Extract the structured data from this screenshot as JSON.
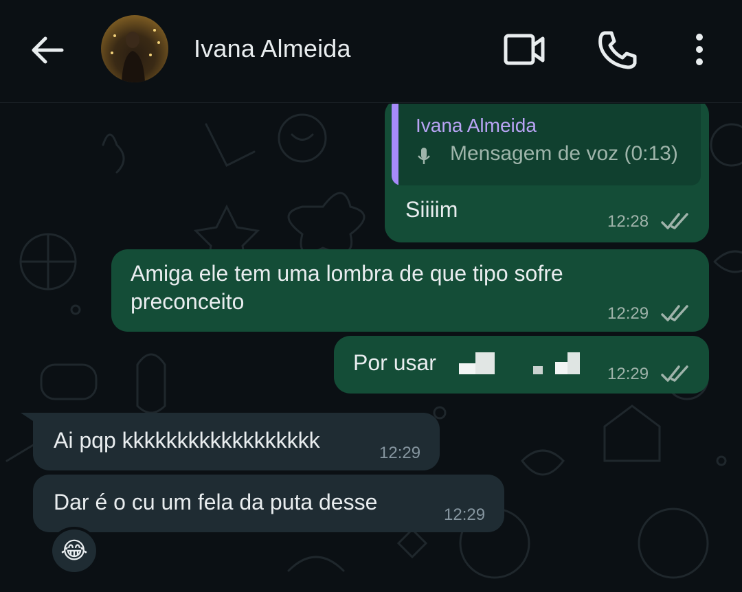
{
  "header": {
    "contact_name": "Ivana Almeida",
    "icons": [
      "back-arrow-icon",
      "video-call-icon",
      "phone-icon",
      "more-options-icon"
    ]
  },
  "messages": [
    {
      "direction": "outgoing",
      "reply_to": {
        "name": "Ivana Almeida",
        "text": "Mensagem de voz (0:13)",
        "icon": "mic-icon"
      },
      "text": "Siiiim",
      "time": "12:28",
      "status": "read"
    },
    {
      "direction": "outgoing",
      "text": "Amiga ele tem uma lombra de que tipo sofre preconceito",
      "line1": "Amiga ele tem uma lombra de que tipo sofre",
      "line2": "preconceito",
      "time": "12:29",
      "status": "read"
    },
    {
      "direction": "outgoing",
      "text": "Por usar",
      "time": "12:29",
      "status": "read",
      "redacted_content": true
    },
    {
      "direction": "incoming",
      "text": "Ai pqp kkkkkkkkkkkkkkkkkk",
      "time": "12:29"
    },
    {
      "direction": "incoming",
      "text": "Dar é o cu um fela da puta desse",
      "time": "12:29",
      "reaction": "😂"
    }
  ],
  "colors": {
    "background": "#0b1014",
    "outgoing_bubble": "#144d37",
    "incoming_bubble": "#1f2c33",
    "quote_accent": "#a78bfa",
    "read_ticks": "#9fb3aa"
  }
}
